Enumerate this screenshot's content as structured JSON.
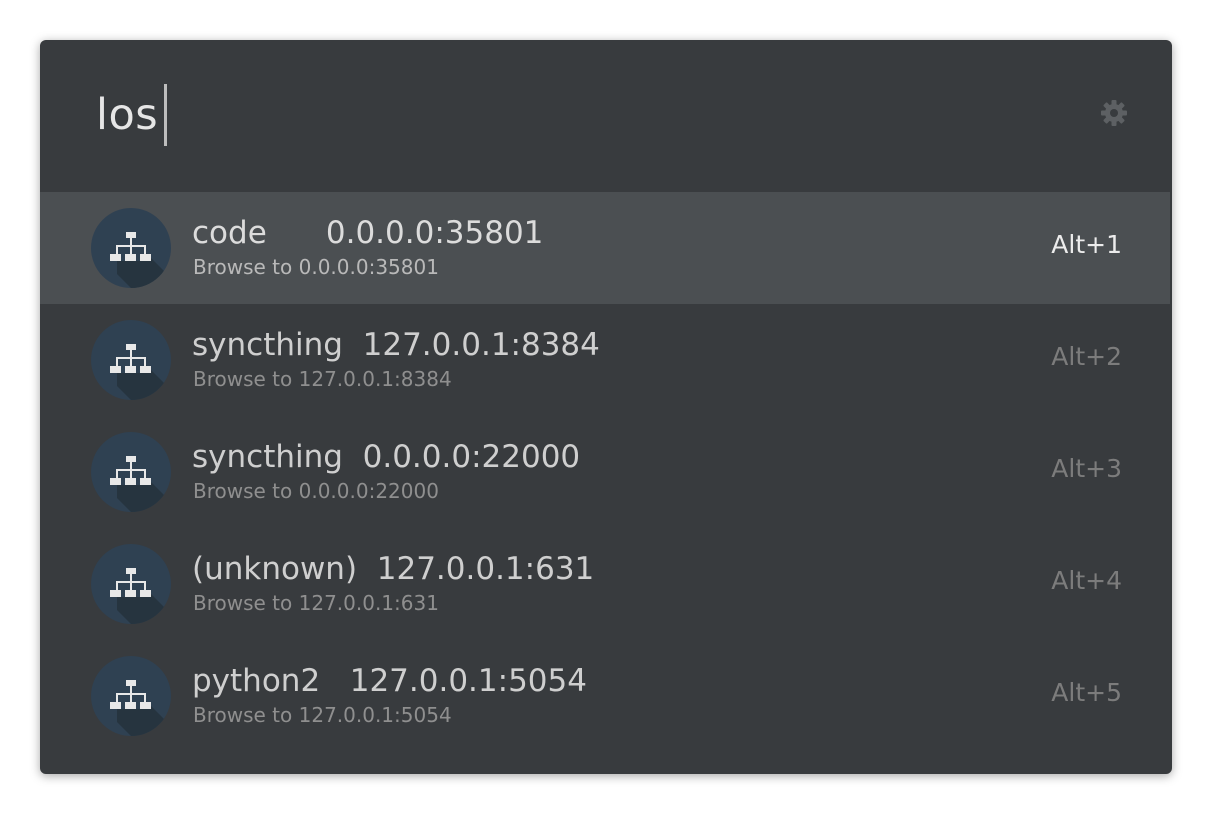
{
  "search": {
    "query": "los"
  },
  "icons": {
    "preferences": "gear-icon",
    "result": "network-hierarchy-icon"
  },
  "colors": {
    "window_bg": "#383b3e",
    "selected_row_bg": "#4b4f52",
    "icon_circle": "#2f4152"
  },
  "results": [
    {
      "name": "code",
      "address": "0.0.0.0:35801",
      "title": "code      0.0.0.0:35801",
      "description": "Browse to 0.0.0.0:35801",
      "shortcut": "Alt+1",
      "selected": true
    },
    {
      "name": "syncthing",
      "address": "127.0.0.1:8384",
      "title": "syncthing  127.0.0.1:8384",
      "description": "Browse to 127.0.0.1:8384",
      "shortcut": "Alt+2",
      "selected": false
    },
    {
      "name": "syncthing",
      "address": "0.0.0.0:22000",
      "title": "syncthing  0.0.0.0:22000",
      "description": "Browse to 0.0.0.0:22000",
      "shortcut": "Alt+3",
      "selected": false
    },
    {
      "name": "(unknown)",
      "address": "127.0.0.1:631",
      "title": "(unknown)  127.0.0.1:631",
      "description": "Browse to 127.0.0.1:631",
      "shortcut": "Alt+4",
      "selected": false
    },
    {
      "name": "python2",
      "address": "127.0.0.1:5054",
      "title": "python2   127.0.0.1:5054",
      "description": "Browse to 127.0.0.1:5054",
      "shortcut": "Alt+5",
      "selected": false
    }
  ]
}
